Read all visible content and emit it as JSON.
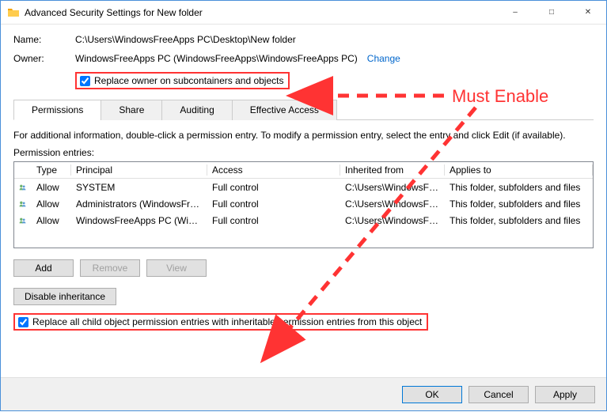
{
  "window": {
    "title": "Advanced Security Settings for New folder"
  },
  "name_label": "Name:",
  "name_value": "C:\\Users\\WindowsFreeApps PC\\Desktop\\New folder",
  "owner_label": "Owner:",
  "owner_value": "WindowsFreeApps PC (WindowsFreeApps\\WindowsFreeApps PC)",
  "change_label": "Change",
  "replace_owner_label": "Replace owner on subcontainers and objects",
  "tabs": {
    "permissions": "Permissions",
    "share": "Share",
    "auditing": "Auditing",
    "effective": "Effective Access"
  },
  "info_text": "For additional information, double-click a permission entry. To modify a permission entry, select the entry and click Edit (if available).",
  "entries_label": "Permission entries:",
  "columns": {
    "type": "Type",
    "principal": "Principal",
    "access": "Access",
    "inherited": "Inherited from",
    "applies": "Applies to"
  },
  "rows": [
    {
      "type": "Allow",
      "principal": "SYSTEM",
      "access": "Full control",
      "inherited": "C:\\Users\\WindowsFree...",
      "applies": "This folder, subfolders and files"
    },
    {
      "type": "Allow",
      "principal": "Administrators (WindowsFree...",
      "access": "Full control",
      "inherited": "C:\\Users\\WindowsFree...",
      "applies": "This folder, subfolders and files"
    },
    {
      "type": "Allow",
      "principal": "WindowsFreeApps PC (Windo...",
      "access": "Full control",
      "inherited": "C:\\Users\\WindowsFree...",
      "applies": "This folder, subfolders and files"
    }
  ],
  "buttons": {
    "add": "Add",
    "remove": "Remove",
    "view": "View",
    "disable_inheritance": "Disable inheritance",
    "ok": "OK",
    "cancel": "Cancel",
    "apply": "Apply"
  },
  "replace_all_label": "Replace all child object permission entries with inheritable permission entries from this object",
  "annotation": "Must Enable"
}
